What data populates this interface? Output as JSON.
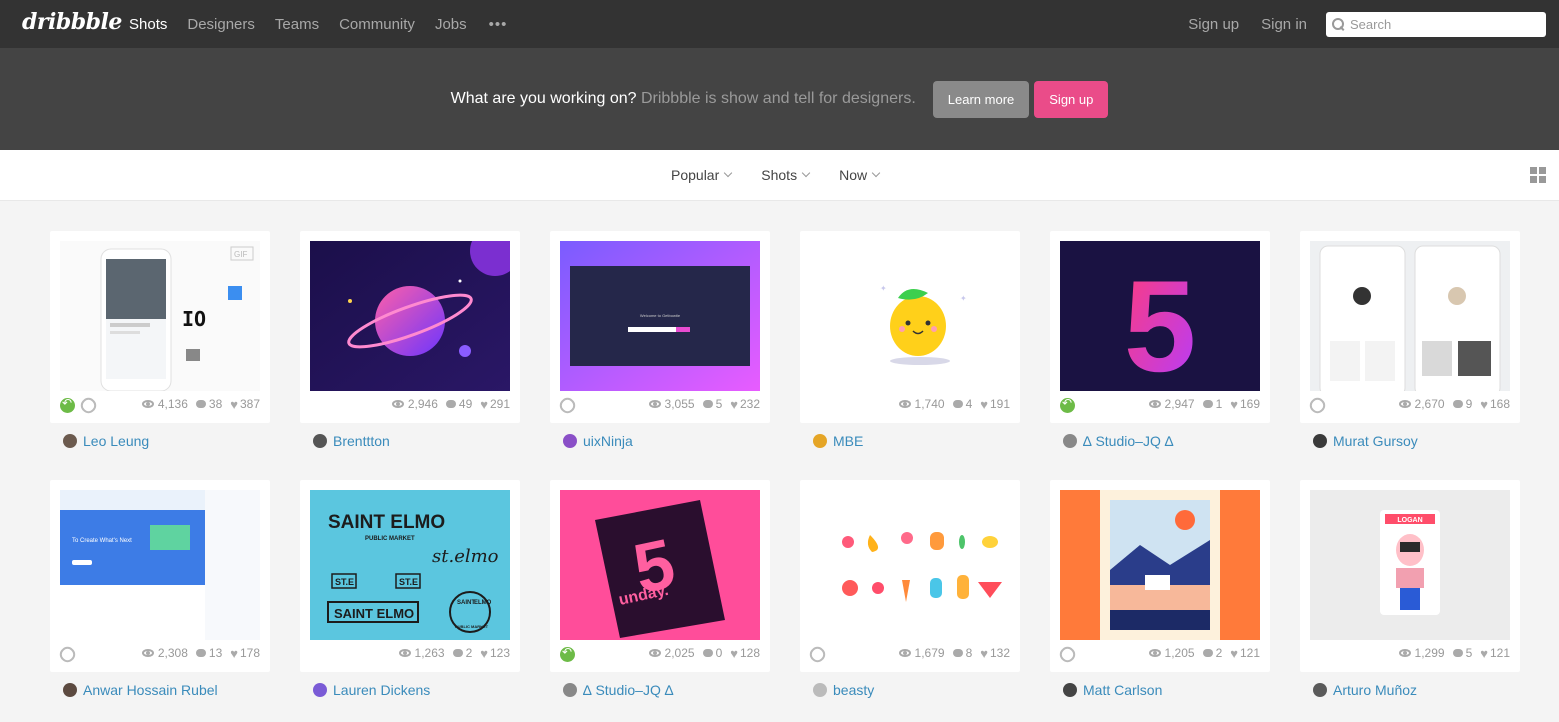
{
  "header": {
    "logo": "dribbble",
    "nav": [
      "Shots",
      "Designers",
      "Teams",
      "Community",
      "Jobs"
    ],
    "more": "•••",
    "sign_up": "Sign up",
    "sign_in": "Sign in",
    "search_placeholder": "Search"
  },
  "banner": {
    "question": "What are you working on?",
    "subtitle": "Dribbble is show and tell for designers.",
    "learn_more": "Learn more",
    "sign_up": "Sign up"
  },
  "filters": [
    "Popular",
    "Shots",
    "Now"
  ],
  "shots": [
    {
      "author": "Leo Leung",
      "views": "4,136",
      "comments": "38",
      "likes": "387",
      "rebound": true,
      "attach": true,
      "avatar_color": "#6b5a4e"
    },
    {
      "author": "Brenttton",
      "views": "2,946",
      "comments": "49",
      "likes": "291",
      "rebound": false,
      "attach": false,
      "avatar_color": "#555555"
    },
    {
      "author": "uixNinja",
      "views": "3,055",
      "comments": "5",
      "likes": "232",
      "rebound": false,
      "attach": true,
      "avatar_color": "#8a4fc7"
    },
    {
      "author": "MBE",
      "views": "1,740",
      "comments": "4",
      "likes": "191",
      "rebound": false,
      "attach": false,
      "avatar_color": "#e5a526"
    },
    {
      "author": "∆ Studio–JQ ∆",
      "views": "2,947",
      "comments": "1",
      "likes": "169",
      "rebound": true,
      "attach": false,
      "avatar_color": "#888888"
    },
    {
      "author": "Murat Gursoy",
      "views": "2,670",
      "comments": "9",
      "likes": "168",
      "rebound": false,
      "attach": true,
      "avatar_color": "#3a3a3a"
    },
    {
      "author": "Anwar Hossain Rubel",
      "views": "2,308",
      "comments": "13",
      "likes": "178",
      "rebound": false,
      "attach": true,
      "avatar_color": "#5c4a40"
    },
    {
      "author": "Lauren Dickens",
      "views": "1,263",
      "comments": "2",
      "likes": "123",
      "rebound": false,
      "attach": false,
      "avatar_color": "#7a5bd6"
    },
    {
      "author": "∆ Studio–JQ ∆",
      "views": "2,025",
      "comments": "0",
      "likes": "128",
      "rebound": true,
      "attach": false,
      "avatar_color": "#888888"
    },
    {
      "author": "beasty",
      "views": "1,679",
      "comments": "8",
      "likes": "132",
      "rebound": false,
      "attach": true,
      "avatar_color": "#bbbbbb"
    },
    {
      "author": "Matt Carlson",
      "views": "1,205",
      "comments": "2",
      "likes": "121",
      "rebound": false,
      "attach": true,
      "avatar_color": "#444444"
    },
    {
      "author": "Arturo Muñoz",
      "views": "1,299",
      "comments": "5",
      "likes": "121",
      "rebound": false,
      "attach": false,
      "avatar_color": "#5a5a5a"
    }
  ],
  "colors": {
    "header_bg": "#333333",
    "banner_bg": "#444444",
    "accent_pink": "#ea4c89",
    "link_blue": "#3a8bbb",
    "rebound_green": "#6dbb47"
  },
  "thumb_art": {
    "s1_big": "IO",
    "s1_gif": "GIF",
    "s3_welcome": "Welcome to Getbowtie",
    "s5_number": "5",
    "s7_left_title": "To Create What's Next",
    "s8_saint_elmo": "SAINT ELMO",
    "s8_public_market": "PUBLIC MARKET",
    "s8_st_elmo": "st.elmo",
    "s8_ste": "ST.E",
    "s8_saint": "SAINT",
    "s8_elmo": "ELMO",
    "s9_number": "5",
    "s9_sunday": "unday.",
    "s12_logan": "LOGAN"
  }
}
